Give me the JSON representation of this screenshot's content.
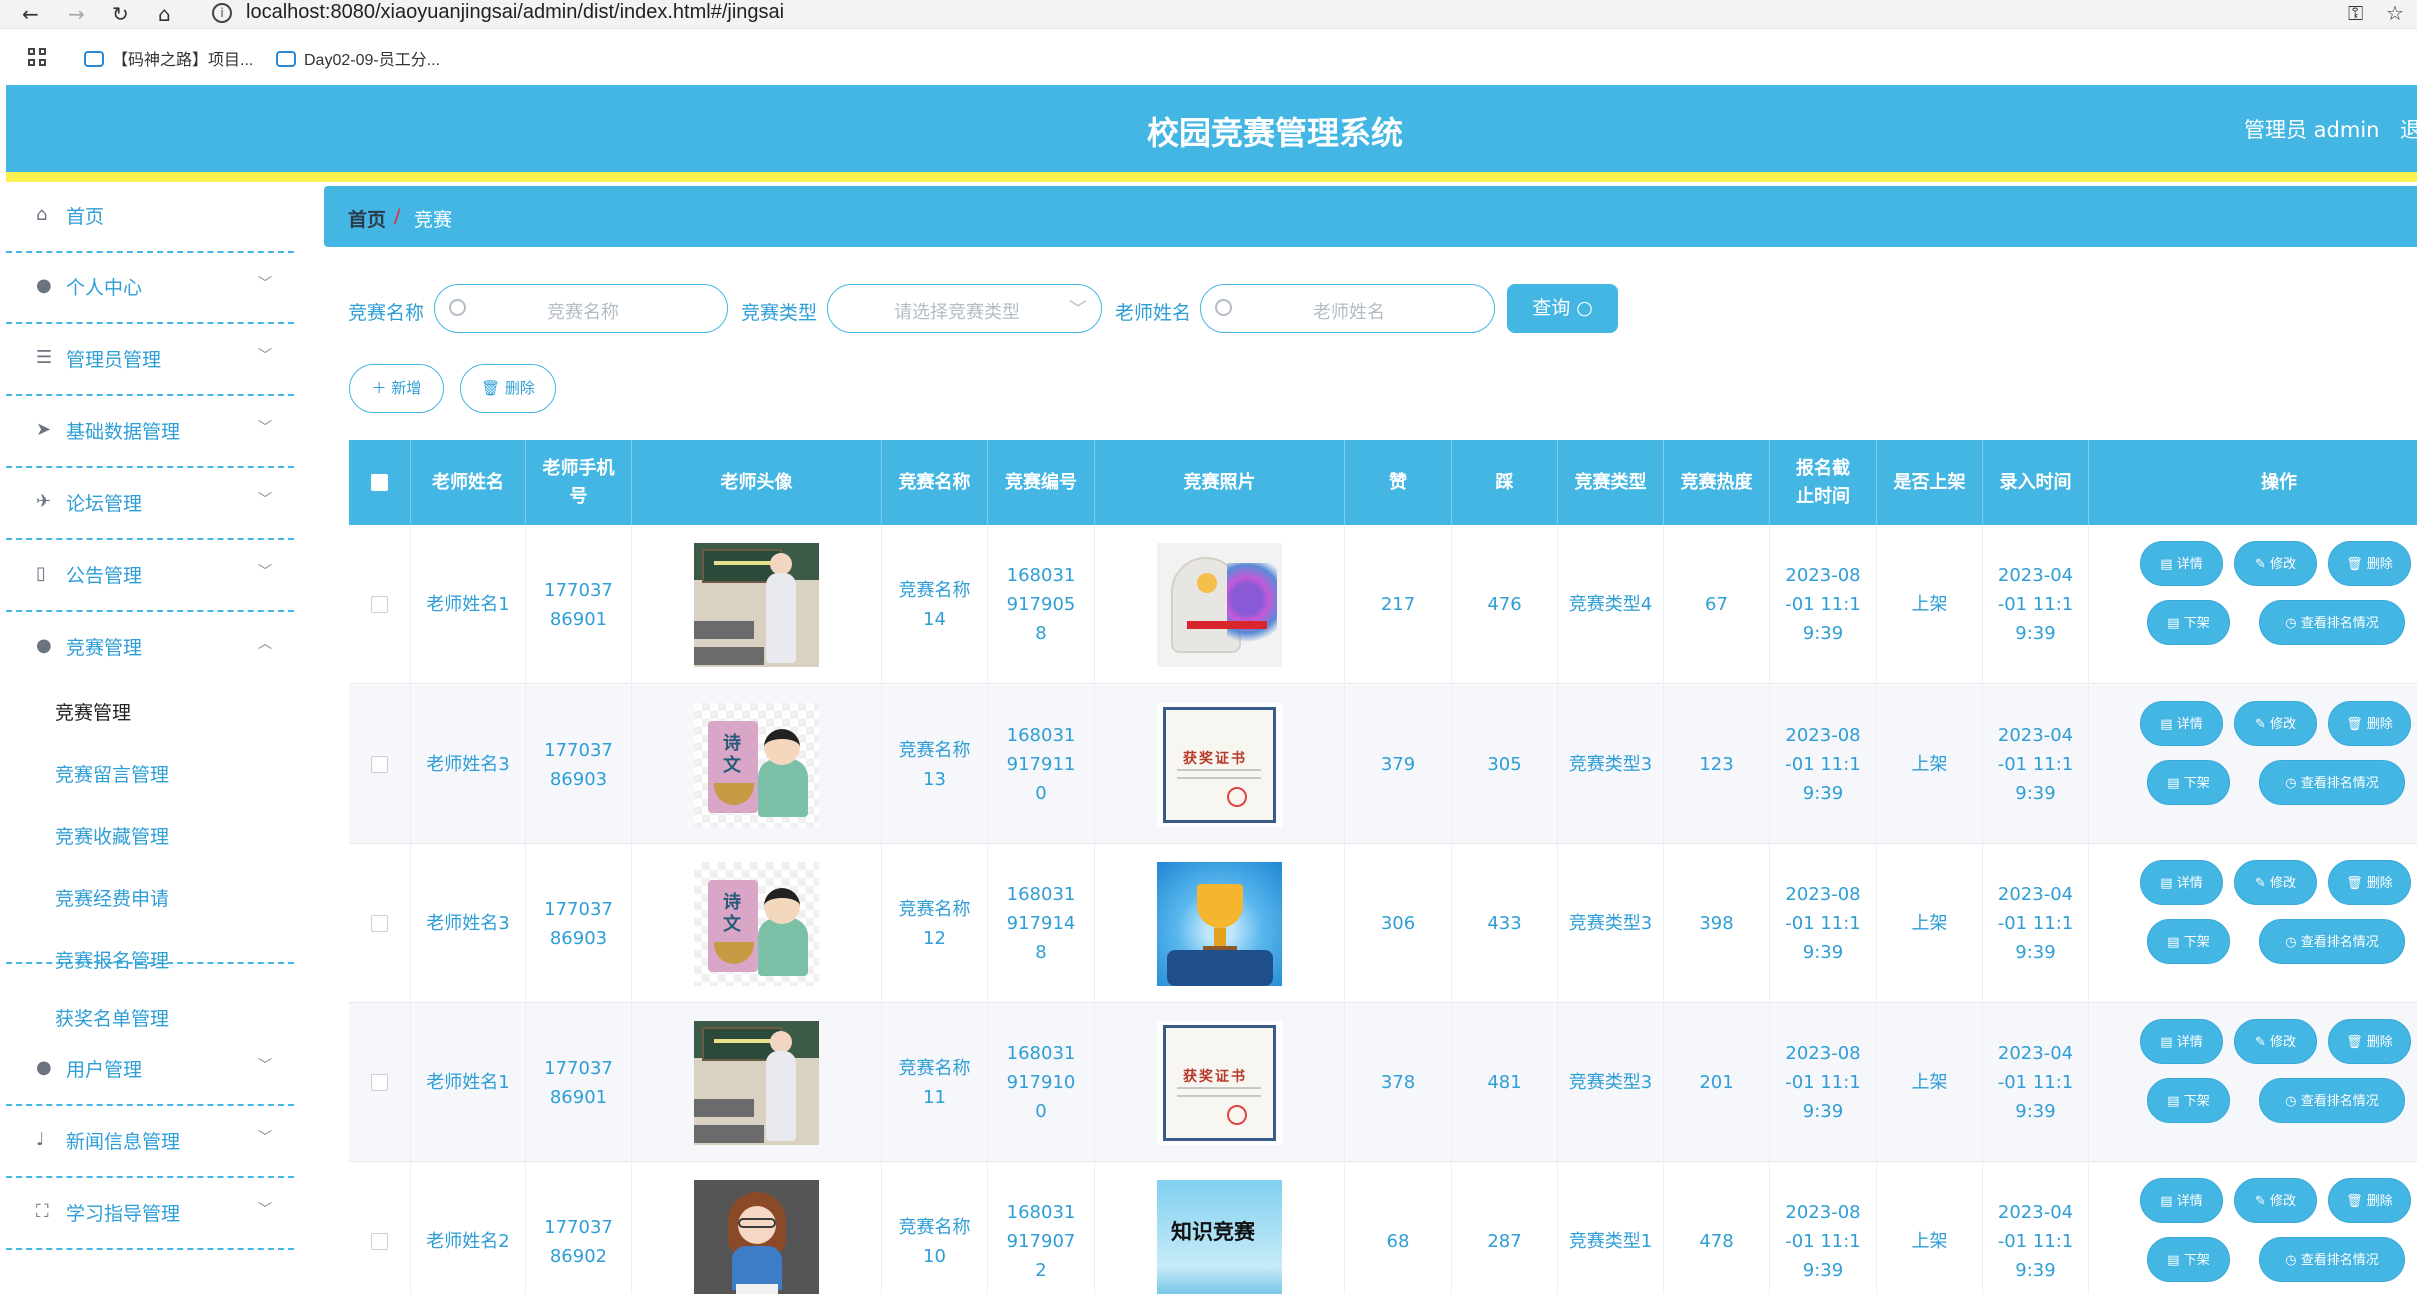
{
  "browser": {
    "url": "localhost:8080/xiaoyuanjingsai/admin/dist/index.html#/jingsai",
    "bookmarks": [
      "【码神之路】项目...",
      "Day02-09-员工分..."
    ]
  },
  "header": {
    "title": "校园竞赛管理系统",
    "user": "管理员 admin",
    "logout": "退"
  },
  "sidebar": {
    "items": [
      {
        "label": "首页",
        "icon": "home-icon"
      },
      {
        "label": "个人中心",
        "icon": "user-icon"
      },
      {
        "label": "管理员管理",
        "icon": "list-icon"
      },
      {
        "label": "基础数据管理",
        "icon": "send-icon"
      },
      {
        "label": "论坛管理",
        "icon": "plane-icon"
      },
      {
        "label": "公告管理",
        "icon": "phone-icon"
      },
      {
        "label": "竞赛管理",
        "icon": "user-icon"
      },
      {
        "label": "用户管理",
        "icon": "user-icon"
      },
      {
        "label": "新闻信息管理",
        "icon": "mic-icon"
      },
      {
        "label": "学习指导管理",
        "icon": "fullscreen-icon"
      }
    ],
    "submenu": [
      "竞赛管理",
      "竞赛留言管理",
      "竞赛收藏管理",
      "竞赛经费申请",
      "竞赛报名管理",
      "获奖名单管理"
    ]
  },
  "breadcrumb": {
    "home": "首页",
    "sep": "/",
    "current": "竞赛"
  },
  "search": {
    "name_label": "竞赛名称",
    "name_placeholder": "竞赛名称",
    "type_label": "竞赛类型",
    "type_placeholder": "请选择竞赛类型",
    "teacher_label": "老师姓名",
    "teacher_placeholder": "老师姓名",
    "query_button": "查询 ○"
  },
  "actions": {
    "add": "＋ 新增",
    "delete": "🗑 删除"
  },
  "table": {
    "headers": [
      "老师姓名",
      "老师手机号",
      "老师头像",
      "竞赛名称",
      "竞赛编号",
      "竞赛照片",
      "赞",
      "踩",
      "竞赛类型",
      "竞赛热度",
      "报名截止时间",
      "是否上架",
      "录入时间",
      "操作"
    ],
    "row_buttons": {
      "detail": "▤ 详情",
      "edit": "✎ 修改",
      "del": "🗑 删除",
      "off": "▤ 下架",
      "rank": "◷ 查看排名情况"
    },
    "rows": [
      {
        "teacher": "老师姓名1",
        "phone": "17703786901",
        "avatar": "classroom",
        "name": "竞赛名称14",
        "code": "1680319179058",
        "photo": "head",
        "up": "217",
        "down": "476",
        "type": "竞赛类型4",
        "heat": "67",
        "deadline": "2023-08-01 11:19:39",
        "status": "上架",
        "created": "2023-04-01 11:19:39"
      },
      {
        "teacher": "老师姓名3",
        "phone": "17703786903",
        "avatar": "poet",
        "name": "竞赛名称13",
        "code": "1680319179110",
        "photo": "cert",
        "up": "379",
        "down": "305",
        "type": "竞赛类型3",
        "heat": "123",
        "deadline": "2023-08-01 11:19:39",
        "status": "上架",
        "created": "2023-04-01 11:19:39"
      },
      {
        "teacher": "老师姓名3",
        "phone": "17703786903",
        "avatar": "poet",
        "name": "竞赛名称12",
        "code": "1680319179148",
        "photo": "trophy",
        "up": "306",
        "down": "433",
        "type": "竞赛类型3",
        "heat": "398",
        "deadline": "2023-08-01 11:19:39",
        "status": "上架",
        "created": "2023-04-01 11:19:39"
      },
      {
        "teacher": "老师姓名1",
        "phone": "17703786901",
        "avatar": "classroom",
        "name": "竞赛名称11",
        "code": "1680319179100",
        "photo": "cert",
        "up": "378",
        "down": "481",
        "type": "竞赛类型3",
        "heat": "201",
        "deadline": "2023-08-01 11:19:39",
        "status": "上架",
        "created": "2023-04-01 11:19:39"
      },
      {
        "teacher": "老师姓名2",
        "phone": "17703786902",
        "avatar": "girl",
        "name": "竞赛名称10",
        "code": "1680319179072",
        "photo": "know",
        "up": "68",
        "down": "287",
        "type": "竞赛类型1",
        "heat": "478",
        "deadline": "2023-08-01 11:19:39",
        "status": "上架",
        "created": "2023-04-01 11:19:39"
      }
    ]
  },
  "picture_text": {
    "poet": "诗文",
    "cert": "获奖证书",
    "know": "知识竞赛"
  },
  "colors": {
    "primary": "#44b6e3",
    "accent_yellow": "#fbf14f",
    "link": "#2f9ed6"
  }
}
